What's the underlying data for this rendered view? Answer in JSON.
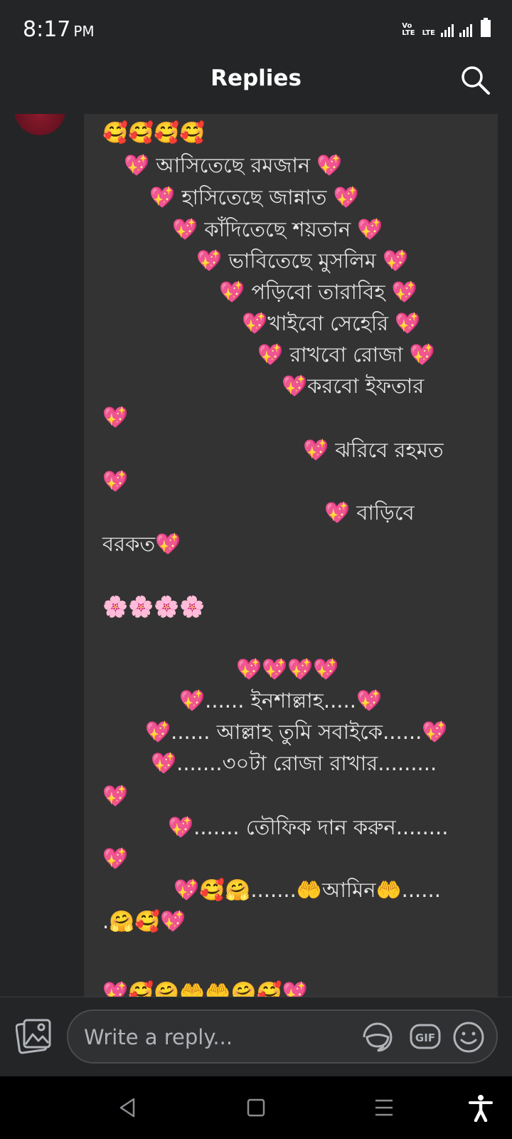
{
  "status_bar": {
    "time": "8:17",
    "ampm": "PM",
    "volte": "Vo\nLTE",
    "lte": "LTE"
  },
  "header": {
    "title": "Replies",
    "icons": {
      "back": "arrow-left-icon",
      "search": "search-icon"
    }
  },
  "comment": {
    "lines": [
      "🥰🥰🥰🥰",
      "💖 আসিতেছে রমজান 💖",
      "💖 হাসিতেছে জান্নাত 💖",
      "💖 কাঁদিতেছে শয়তান 💖",
      "💖 ভাবিতেছে মুসলিম 💖",
      "💖 পড়িবো তারাবিহ 💖",
      "💖খাইবো সেহেরি  💖",
      "💖 রাখবো রোজা   💖",
      "💖করবো ইফতার",
      "💖",
      "💖 ঝরিবে রহমত",
      "💖",
      "💖 বাড়িবে",
      "বরকত💖",
      "🌸🌸🌸🌸",
      "💖💖💖💖",
      "💖...... ইনশাল্লাহ.....💖",
      "💖...... আল্লাহ তুমি সবাইকে......💖",
      "💖.......৩০টা রোজা রাখার.........",
      "💖",
      "💖....... তৌফিক দান করুন........",
      "💖",
      "💖🥰🤗.......🤲আমিন🤲......",
      ".🤗🥰💖",
      "💖🥰🤗🤲🤲🤗🥰💖"
    ]
  },
  "composer": {
    "placeholder": "Write a reply...",
    "gif_label": "GIF",
    "icons": {
      "photo": "photo-icon",
      "sticker": "sticker-icon",
      "gif": "gif-icon",
      "emoji": "emoji-icon"
    }
  },
  "nav_bar": {
    "icons": [
      "back-triangle-icon",
      "home-square-icon",
      "menu-lines-icon",
      "accessibility-icon"
    ]
  },
  "colors": {
    "background": "#242526",
    "bubble": "#333334",
    "text": "#e6e6e6",
    "nav": "#000000"
  }
}
